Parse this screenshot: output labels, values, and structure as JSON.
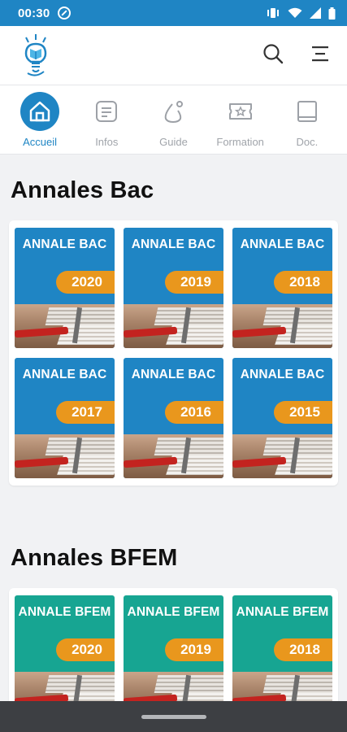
{
  "status_bar": {
    "time": "00:30",
    "icons": [
      "data-saver-icon",
      "vibrate-icon",
      "wifi-icon",
      "signal-icon",
      "battery-icon"
    ],
    "color": "#1f85c4"
  },
  "app_bar": {
    "logo": "lightbulb-book-logo",
    "icons": [
      "search-icon",
      "menu-icon"
    ]
  },
  "tabs": [
    {
      "label": "Accueil",
      "icon": "home-icon",
      "active": true
    },
    {
      "label": "Infos",
      "icon": "document-list-icon",
      "active": false
    },
    {
      "label": "Guide",
      "icon": "guide-icon",
      "active": false
    },
    {
      "label": "Formation",
      "icon": "ticket-star-icon",
      "active": false
    },
    {
      "label": "Doc.",
      "icon": "book-icon",
      "active": false
    }
  ],
  "sections": [
    {
      "title": "Annales Bac",
      "color": "#1f85c4",
      "cards": [
        {
          "title": "ANNALE BAC",
          "year": "2020"
        },
        {
          "title": "ANNALE BAC",
          "year": "2019"
        },
        {
          "title": "ANNALE BAC",
          "year": "2018"
        },
        {
          "title": "ANNALE BAC",
          "year": "2017"
        },
        {
          "title": "ANNALE BAC",
          "year": "2016"
        },
        {
          "title": "ANNALE BAC",
          "year": "2015"
        }
      ]
    },
    {
      "title": "Annales BFEM",
      "color": "#17a592",
      "cards": [
        {
          "title": "ANNALE BFEM",
          "year": "2020"
        },
        {
          "title": "ANNALE BFEM",
          "year": "2019"
        },
        {
          "title": "ANNALE BFEM",
          "year": "2018"
        }
      ]
    }
  ],
  "accent_colors": {
    "primary": "#1f85c4",
    "badge": "#e9971d",
    "teal": "#17a592"
  }
}
